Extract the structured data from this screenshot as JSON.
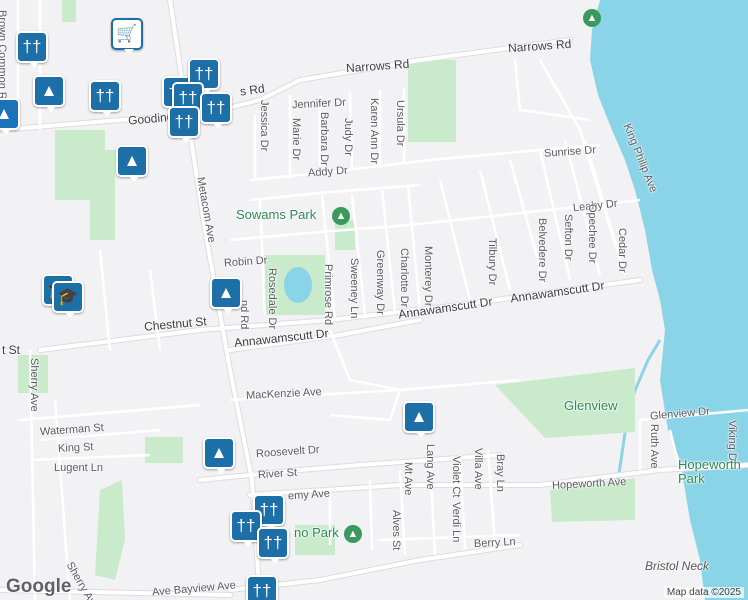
{
  "colors": {
    "background": "#f2f2f5",
    "water": "#8ad4e8",
    "park": "#c9ebcc",
    "road": "#ffffff",
    "road_outline": "#dcdce2",
    "major_road": "#d3d6dc",
    "marker": "#1d6fa8",
    "park_marker": "#3a9a5d"
  },
  "streets": {
    "narrows_rd": "Narrows Rd",
    "s_rd": "s Rd",
    "gooding_av": "Gooding Av",
    "jessica_dr": "Jessica Dr",
    "marie_dr": "Marie Dr",
    "barbara_dr": "Barbara Dr",
    "jennifer_dr": "Jennifer Dr",
    "judy_dr": "Judy Dr",
    "karen_ann_dr": "Karen Ann Dr",
    "ursula_dr": "Ursula Dr",
    "addy_dr": "Addy Dr",
    "sunrise_dr": "Sunrise Dr",
    "king_philip_ave": "King Philip Ave",
    "leahy_dr": "Leahy Dr",
    "metacom_ave": "Metacom Ave",
    "robin_dr": "Robin Dr",
    "rosedale_dr": "Rosedale Dr",
    "primrose_rd": "Primrose Rd",
    "sweeney_ln": "Sweeney Ln",
    "greenway_dr": "Greenway Dr",
    "charlotte_dr": "Charlotte Dr",
    "monterey_dr": "Monterey Dr",
    "tilbury_dr": "Tilbury Dr",
    "belvedere_dr": "Belvedere Dr",
    "sefton_dr": "Sefton Dr",
    "opechee_dr": "Opechee Dr",
    "cedar_dr": "Cedar Dr",
    "annawamscutt_dr": "Annawamscutt Dr",
    "chestnut_st": "Chestnut St",
    "nd_rd": "nd Rd",
    "brownmmon_rd": "Brown Common Rd",
    "t_st": "t St",
    "sherry_ave": "Sherry Ave",
    "mackenzie_ave": "MacKenzie Ave",
    "waterman_st": "Waterman St",
    "king_st": "King St",
    "lugent_ln": "Lugent Ln",
    "roosevelt_dr": "Roosevelt Dr",
    "river_st": "River St",
    "jeremy_ave": "emy Ave",
    "mt_ave": "Mt Ave",
    "lang_ave": "Lang Ave",
    "violet_ct": "Violet Ct",
    "verdi_ln": "Verdi Ln",
    "villa_ave": "Villa Ave",
    "bray_ln": "Bray Ln",
    "alves_st": "Alves St",
    "berry_ln": "Berry Ln",
    "hopeworth_ave": "Hopeworth Ave",
    "glenview_dr": "Glenview Dr",
    "ruth_ave": "Ruth Ave",
    "viking_dr": "Viking Dr",
    "bayview_ave": "Ave Bayview Ave",
    "sherry_ave2": "Sherry Ave"
  },
  "places": {
    "sowams_park": "Sowams Park",
    "glenview": "Glenview",
    "hopeworth_park": "Hopeworth Park",
    "mo_park": "no Park",
    "bristol_neck": "Bristol Neck"
  },
  "markers": [
    {
      "type": "food",
      "icon": "fork-knife-icon",
      "glyph": "††"
    },
    {
      "type": "shopping-cart",
      "icon": "cart-icon",
      "glyph": "🛒"
    },
    {
      "type": "shopping",
      "icon": "bag-icon",
      "glyph": "▲"
    },
    {
      "type": "school",
      "icon": "graduation-cap-icon",
      "glyph": "🎓"
    }
  ],
  "footer": {
    "logo": "Google",
    "copyright": "Map data ©2025"
  }
}
